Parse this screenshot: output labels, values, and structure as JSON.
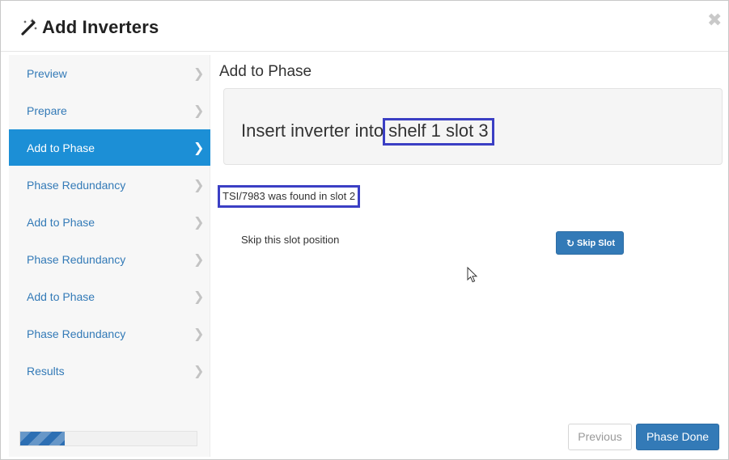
{
  "dialog": {
    "title": "Add Inverters",
    "title_icon": "magic-wand-icon",
    "close_glyph": "✖"
  },
  "sidebar": {
    "chevron": "❯",
    "active_color": "#1c8fd6",
    "link_color": "#337ab7",
    "items": [
      {
        "label": "Preview",
        "active": false
      },
      {
        "label": "Prepare",
        "active": false
      },
      {
        "label": "Add to Phase",
        "active": true
      },
      {
        "label": "Phase Redundancy",
        "active": false
      },
      {
        "label": "Add to Phase",
        "active": false
      },
      {
        "label": "Phase Redundancy",
        "active": false
      },
      {
        "label": "Add to Phase",
        "active": false
      },
      {
        "label": "Phase Redundancy",
        "active": false
      },
      {
        "label": "Results",
        "active": false
      }
    ],
    "progress_fraction": 0.25
  },
  "main": {
    "section_title": "Add to Phase",
    "instruction_prefix": "Insert inverter into",
    "instruction_target": "shelf 1 slot 3",
    "found_message": "TSI/7983 was found in slot 2",
    "skip_text": "Skip this slot position",
    "skip_button": {
      "icon": "refresh-icon",
      "glyph": "↻",
      "label": "Skip Slot"
    },
    "highlight_color": "#3b3fc4"
  },
  "footer": {
    "previous_label": "Previous",
    "done_label": "Phase Done"
  }
}
